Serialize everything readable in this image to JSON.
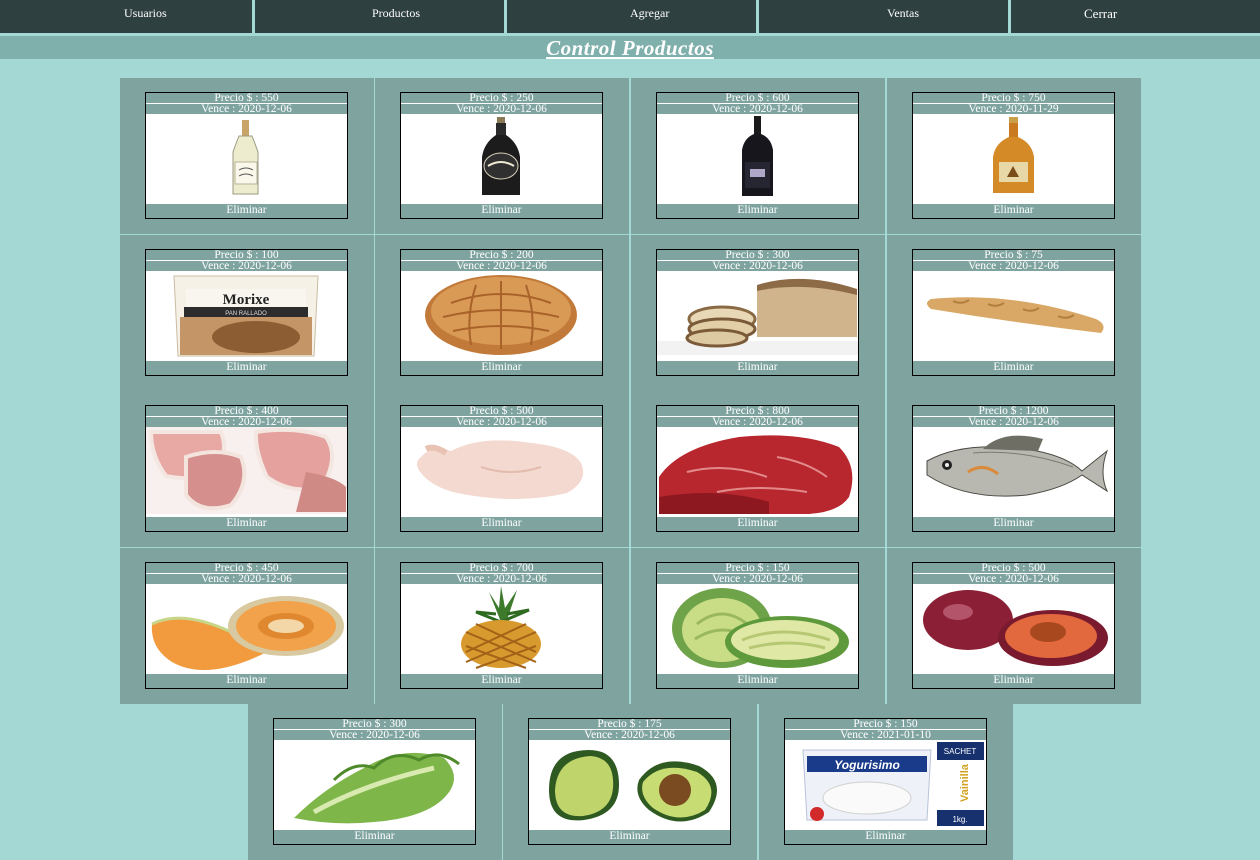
{
  "nav": [
    "Usuarios",
    "Productos",
    "Agregar",
    "Ventas",
    "Cerrar"
  ],
  "title": "Control Productos",
  "delete_label": "Eliminar",
  "products": [
    {
      "price": "Precio $ : 550",
      "exp": "Vence : 2020-12-06",
      "icon": "white-wine-bottle-icon"
    },
    {
      "price": "Precio $ : 250",
      "exp": "Vence : 2020-12-06",
      "icon": "dark-beer-bottle-icon"
    },
    {
      "price": "Precio $ : 600",
      "exp": "Vence : 2020-12-06",
      "icon": "red-wine-bottle-icon"
    },
    {
      "price": "Precio $ : 750",
      "exp": "Vence : 2020-11-29",
      "icon": "amber-beer-bottle-icon"
    },
    {
      "price": "Precio $ : 100",
      "exp": "Vence : 2020-12-06",
      "icon": "breadcrumb-bag-icon"
    },
    {
      "price": "Precio $ : 200",
      "exp": "Vence : 2020-12-06",
      "icon": "round-bread-icon"
    },
    {
      "price": "Precio $ : 300",
      "exp": "Vence : 2020-12-06",
      "icon": "sliced-bread-icon"
    },
    {
      "price": "Precio $ : 75",
      "exp": "Vence : 2020-12-06",
      "icon": "baguette-icon"
    },
    {
      "price": "Precio $ : 400",
      "exp": "Vence : 2020-12-06",
      "icon": "pork-chops-icon"
    },
    {
      "price": "Precio $ : 500",
      "exp": "Vence : 2020-12-06",
      "icon": "raw-chicken-icon"
    },
    {
      "price": "Precio $ : 800",
      "exp": "Vence : 2020-12-06",
      "icon": "beef-steak-icon"
    },
    {
      "price": "Precio $ : 1200",
      "exp": "Vence : 2020-12-06",
      "icon": "fish-icon"
    },
    {
      "price": "Precio $ : 450",
      "exp": "Vence : 2020-12-06",
      "icon": "cantaloupe-icon"
    },
    {
      "price": "Precio $ : 700",
      "exp": "Vence : 2020-12-06",
      "icon": "pineapple-icon"
    },
    {
      "price": "Precio $ : 150",
      "exp": "Vence : 2020-12-06",
      "icon": "cabbage-icon"
    },
    {
      "price": "Precio $ : 500",
      "exp": "Vence : 2020-12-06",
      "icon": "plum-icon"
    },
    {
      "price": "Precio $ : 300",
      "exp": "Vence : 2020-12-06",
      "icon": "lettuce-icon"
    },
    {
      "price": "Precio $ : 175",
      "exp": "Vence : 2020-12-06",
      "icon": "avocado-icon"
    },
    {
      "price": "Precio $ : 150",
      "exp": "Vence : 2021-01-10",
      "icon": "yogurt-sachet-icon"
    }
  ],
  "package_text": {
    "morixe_brand": "Morixe",
    "morixe_sub": "PAN RALLADO",
    "yogurt_brand": "Yogurisimo",
    "yogurt_badge": "SACHET",
    "yogurt_flavor": "Vainilla",
    "yogurt_weight": "1kg."
  },
  "colors": {
    "nav_bg": "#2f4040",
    "page_bg": "#a4d8d4",
    "header_bg": "#80b0ac",
    "cell_bg": "#7fa4a0"
  }
}
